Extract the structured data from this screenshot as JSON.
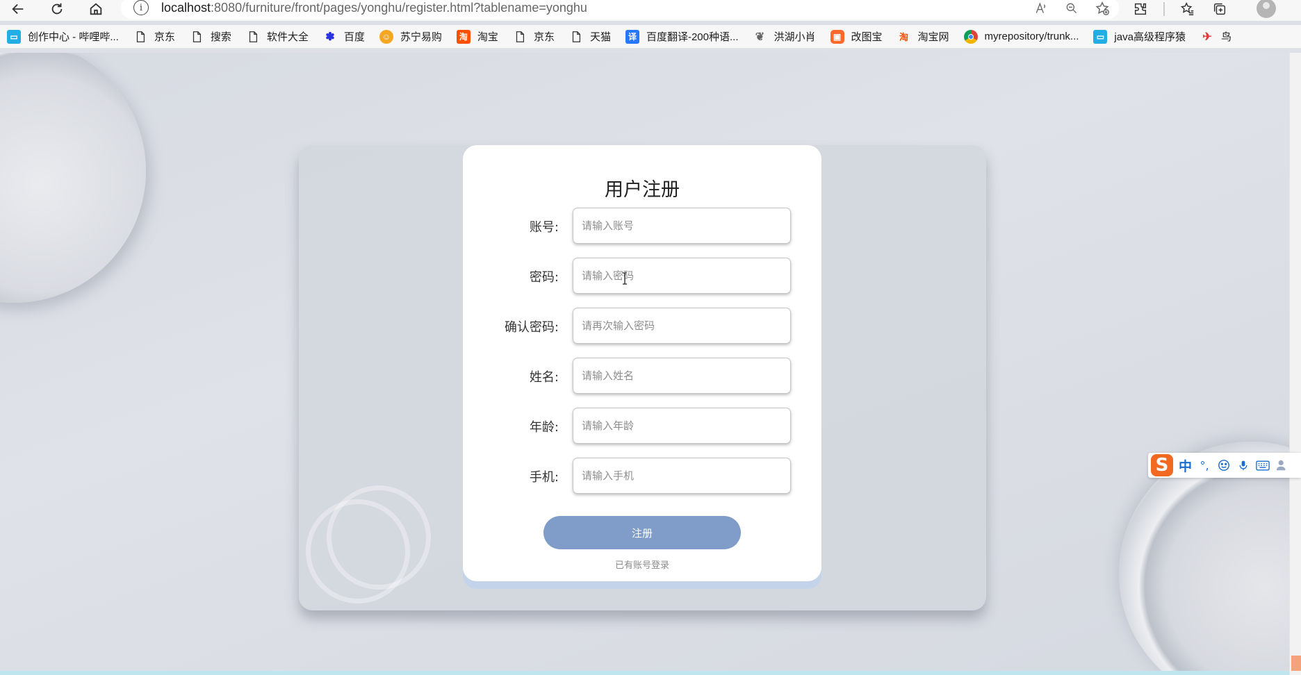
{
  "browser": {
    "url_host": "localhost",
    "url_rest": ":8080/furniture/front/pages/yonghu/register.html?tablename=yonghu",
    "nav_icons": [
      "back-arrow-icon",
      "refresh-icon",
      "home-icon",
      "site-info-icon"
    ],
    "url_actions": [
      "read-aloud-icon",
      "zoom-out-icon",
      "add-favorite-icon"
    ],
    "toolbar_icons": [
      "extensions-icon",
      "favorites-icon",
      "collections-icon",
      "profile-avatar-icon"
    ]
  },
  "bookmarks": [
    {
      "label": "创作中心 - 哔哩哔...",
      "icon": "bilibili-icon",
      "color": "#23ade5"
    },
    {
      "label": "京东",
      "icon": "page-icon",
      "color": ""
    },
    {
      "label": "搜索",
      "icon": "page-icon",
      "color": ""
    },
    {
      "label": "软件大全",
      "icon": "page-icon",
      "color": ""
    },
    {
      "label": "百度",
      "icon": "baidu-paw-icon",
      "color": "#2932e1"
    },
    {
      "label": "苏宁易购",
      "icon": "suning-icon",
      "color": "#f5a623"
    },
    {
      "label": "淘宝",
      "icon": "taobao-icon",
      "color": "#ff5000"
    },
    {
      "label": "京东",
      "icon": "page-icon",
      "color": ""
    },
    {
      "label": "天猫",
      "icon": "page-icon",
      "color": ""
    },
    {
      "label": "百度翻译-200种语...",
      "icon": "baidu-translate-icon",
      "color": "#2878ff"
    },
    {
      "label": "洪湖小肖",
      "icon": "bird-icon",
      "color": "#666666"
    },
    {
      "label": "改图宝",
      "icon": "gaitubao-icon",
      "color": "#ff6a2b"
    },
    {
      "label": "淘宝网",
      "icon": "taobao-icon",
      "color": "#ff5000"
    },
    {
      "label": "myrepository/trunk...",
      "icon": "chrome-icon",
      "color": "#db4437"
    },
    {
      "label": "java高级程序猿",
      "icon": "bilibili-icon",
      "color": "#23ade5"
    },
    {
      "label": "鸟",
      "icon": "bird-red-icon",
      "color": "#e4393c"
    }
  ],
  "form": {
    "title": "用户注册",
    "fields": [
      {
        "label": "账号:",
        "placeholder": "请输入账号",
        "value": ""
      },
      {
        "label": "密码:",
        "placeholder": "请输入密码",
        "value": ""
      },
      {
        "label": "确认密码:",
        "placeholder": "请再次输入密码",
        "value": ""
      },
      {
        "label": "姓名:",
        "placeholder": "请输入姓名",
        "value": ""
      },
      {
        "label": "年龄:",
        "placeholder": "请输入年龄",
        "value": ""
      },
      {
        "label": "手机:",
        "placeholder": "请输入手机",
        "value": ""
      }
    ],
    "submit_label": "注册",
    "login_link": "已有账号登录",
    "accent_color": "#7f9dc8"
  },
  "ime": {
    "logo": "S",
    "mode": "中",
    "icons": [
      "punctuation-icon",
      "emoji-icon",
      "microphone-icon",
      "keyboard-icon",
      "skin-icon"
    ]
  }
}
